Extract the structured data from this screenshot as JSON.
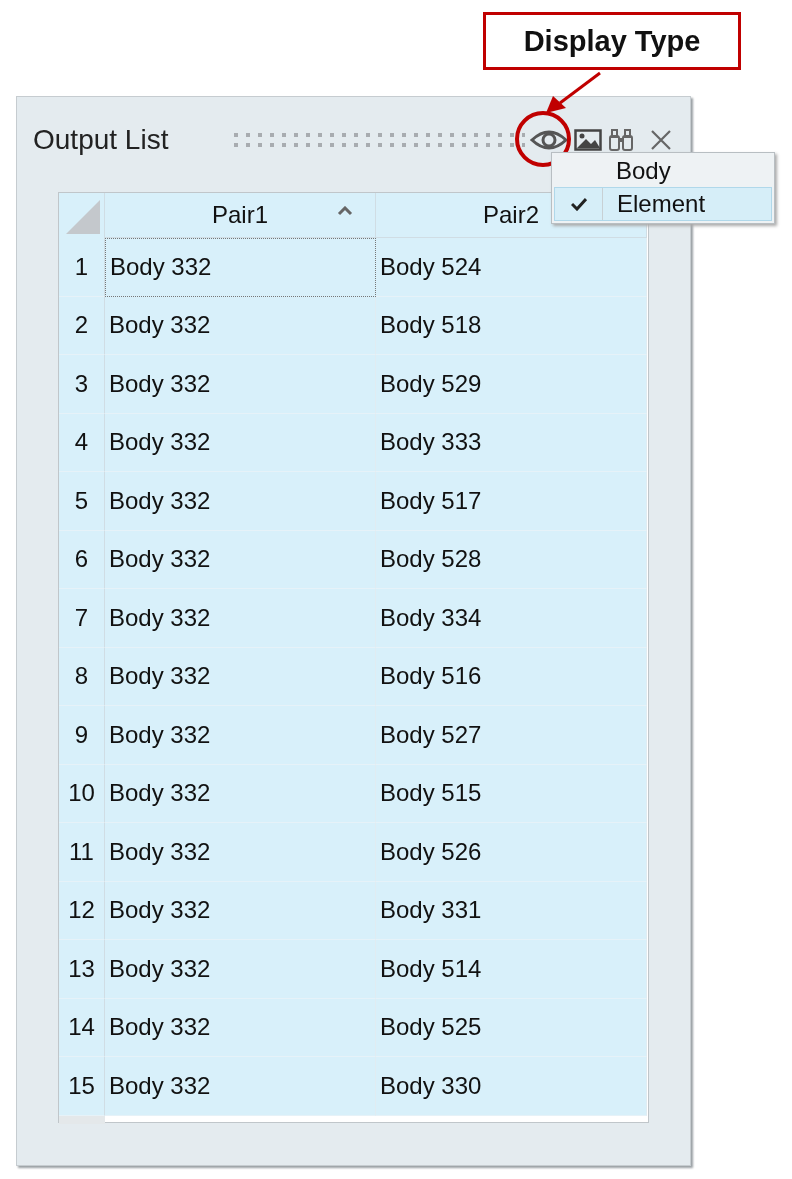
{
  "callout": {
    "label": "Display Type"
  },
  "panel": {
    "title": "Output List"
  },
  "menu": {
    "items": [
      {
        "label": "Body",
        "checked": false,
        "selected": false
      },
      {
        "label": "Element",
        "checked": true,
        "selected": true
      }
    ]
  },
  "table": {
    "columns": [
      {
        "label": "Pair1",
        "sorted": true
      },
      {
        "label": "Pair2"
      }
    ],
    "rows": [
      {
        "number": "1",
        "pair1": "Body 332",
        "pair2": "Body 524",
        "focused": true
      },
      {
        "number": "2",
        "pair1": "Body 332",
        "pair2": "Body 518",
        "focused": false
      },
      {
        "number": "3",
        "pair1": "Body 332",
        "pair2": "Body 529",
        "focused": false
      },
      {
        "number": "4",
        "pair1": "Body 332",
        "pair2": "Body 333",
        "focused": false
      },
      {
        "number": "5",
        "pair1": "Body 332",
        "pair2": "Body 517",
        "focused": false
      },
      {
        "number": "6",
        "pair1": "Body 332",
        "pair2": "Body 528",
        "focused": false
      },
      {
        "number": "7",
        "pair1": "Body 332",
        "pair2": "Body 334",
        "focused": false
      },
      {
        "number": "8",
        "pair1": "Body 332",
        "pair2": "Body 516",
        "focused": false
      },
      {
        "number": "9",
        "pair1": "Body 332",
        "pair2": "Body 527",
        "focused": false
      },
      {
        "number": "10",
        "pair1": "Body 332",
        "pair2": "Body 515",
        "focused": false
      },
      {
        "number": "11",
        "pair1": "Body 332",
        "pair2": "Body 526",
        "focused": false
      },
      {
        "number": "12",
        "pair1": "Body 332",
        "pair2": "Body 331",
        "focused": false
      },
      {
        "number": "13",
        "pair1": "Body 332",
        "pair2": "Body 514",
        "focused": false
      },
      {
        "number": "14",
        "pair1": "Body 332",
        "pair2": "Body 525",
        "focused": false
      },
      {
        "number": "15",
        "pair1": "Body 332",
        "pair2": "Body 330",
        "focused": false
      }
    ]
  }
}
